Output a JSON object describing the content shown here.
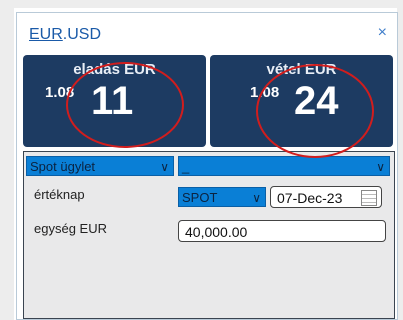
{
  "header": {
    "ccy1": "EUR",
    "sep": ".",
    "ccy2": "USD",
    "close": "×"
  },
  "sell": {
    "label": "eladás EUR",
    "small": "1.08",
    "big": "11"
  },
  "buy": {
    "label": "vétel EUR",
    "small": "1.08",
    "big": "24"
  },
  "form": {
    "product": "Spot ügylet",
    "account": "_",
    "value_date_label": "értéknap",
    "tenor": "SPOT",
    "date": "07-Dec-23",
    "amount_label": "egység EUR",
    "amount": "40,000.00"
  },
  "colors": {
    "tile": "#1d3b62",
    "select": "#0a7fd6",
    "annotation": "#d11d1d"
  },
  "icons": {
    "close": "close-icon",
    "chevron": "chevron-down-icon",
    "calendar": "calendar-icon"
  }
}
